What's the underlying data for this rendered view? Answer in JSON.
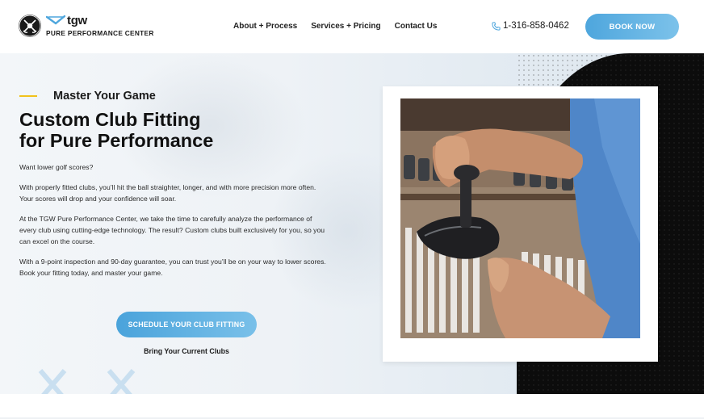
{
  "brand": {
    "name": "tgw",
    "subtitle": "PURE PERFORMANCE CENTER"
  },
  "nav": {
    "items": [
      {
        "label": "About + Process"
      },
      {
        "label": "Services + Pricing"
      },
      {
        "label": "Contact Us"
      }
    ]
  },
  "header": {
    "phone": "1-316-858-0462",
    "book_label": "BOOK NOW"
  },
  "hero": {
    "eyebrow": "Master Your Game",
    "headline_line1": "Custom Club Fitting",
    "headline_line2": "for Pure Performance",
    "paragraphs": [
      "Want lower golf scores?",
      "With properly fitted clubs, you’ll hit the ball straighter, longer, and with more precision more often. Your scores will drop and your confidence will soar.",
      "At the TGW Pure Performance Center, we take the time to carefully analyze the performance of every club using cutting-edge technology. The result? Custom clubs built exclusively for you, so you can excel on the course.",
      "With a 9-point inspection and 90-day guarantee, you can trust you’ll be on your way to lower scores. Book your fitting today, and master your game."
    ],
    "cta_label": "SCHEDULE YOUR CLUB FITTING",
    "cta_sub": "Bring Your Current Clubs"
  },
  "colors": {
    "accent_blue": "#4ea6dd",
    "accent_yellow": "#f2c21b",
    "dark": "#0c0c0c"
  },
  "icons": {
    "phone": "phone-icon",
    "logo": "golf-crest-icon"
  }
}
